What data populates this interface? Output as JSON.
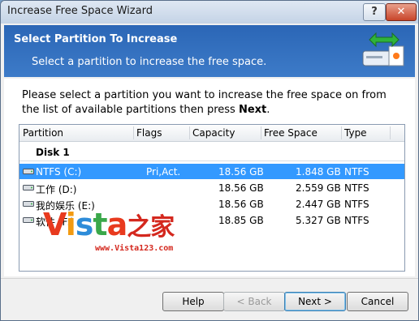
{
  "window": {
    "title": "Increase Free Space Wizard",
    "help_glyph": "?",
    "close_glyph": "✕"
  },
  "banner": {
    "title": "Select Partition To Increase",
    "subtitle": "Select a partition to increase the free space.",
    "icon": "disk-arrows-icon"
  },
  "instruction": {
    "prefix": "Please select a partition you want to increase the free space on from the list of available partitions then press ",
    "bold": "Next",
    "suffix": "."
  },
  "list": {
    "columns": [
      "Partition",
      "Flags",
      "Capacity",
      "Free Space",
      "Type"
    ],
    "group": "Disk 1",
    "rows": [
      {
        "partition": "NTFS (C:)",
        "flags": "Pri,Act.",
        "capacity": "18.56 GB",
        "free": "1.848 GB",
        "type": "NTFS",
        "selected": true
      },
      {
        "partition": "工作 (D:)",
        "flags": "",
        "capacity": "18.56 GB",
        "free": "2.559 GB",
        "type": "NTFS",
        "selected": false
      },
      {
        "partition": "我的娱乐 (E:)",
        "flags": "",
        "capacity": "18.56 GB",
        "free": "2.447 GB",
        "type": "NTFS",
        "selected": false
      },
      {
        "partition": "软件 (F:)",
        "flags": "",
        "capacity": "18.85 GB",
        "free": "5.327 GB",
        "type": "NTFS",
        "selected": false
      }
    ]
  },
  "watermark": {
    "text": "Vista之家",
    "url": "www.Vista123.com"
  },
  "buttons": {
    "help": "Help",
    "back": "< Back",
    "next": "Next >",
    "cancel": "Cancel"
  },
  "colors": {
    "banner": "#2b66b6",
    "selection": "#3399ff"
  }
}
